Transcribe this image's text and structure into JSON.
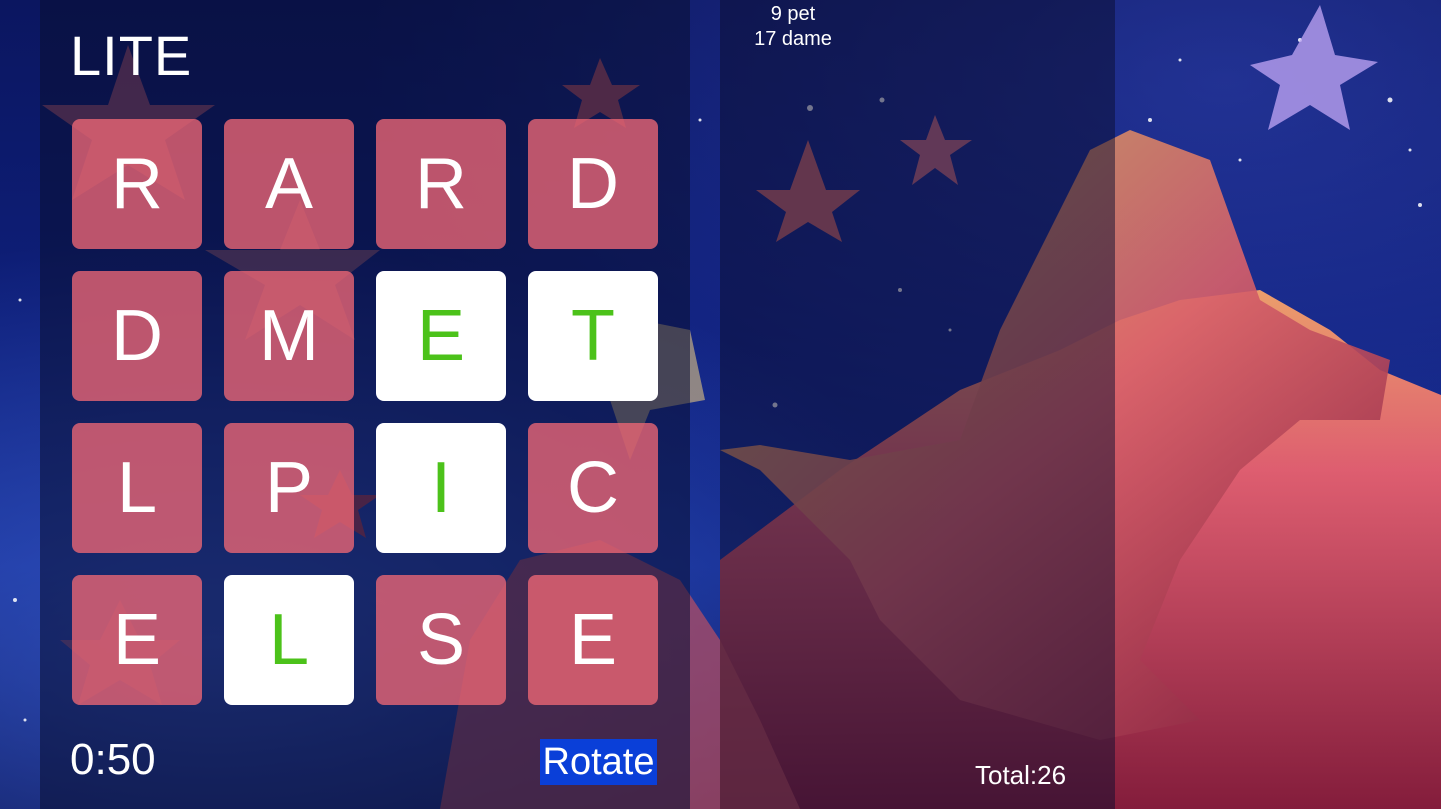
{
  "game": {
    "mode": "LITE",
    "timer": "0:50",
    "rotate_label": "Rotate",
    "total": "Total:26"
  },
  "board": {
    "rows": [
      [
        {
          "letter": "R",
          "selected": false
        },
        {
          "letter": "A",
          "selected": false
        },
        {
          "letter": "R",
          "selected": false
        },
        {
          "letter": "D",
          "selected": false
        }
      ],
      [
        {
          "letter": "D",
          "selected": false
        },
        {
          "letter": "M",
          "selected": false
        },
        {
          "letter": "E",
          "selected": true
        },
        {
          "letter": "T",
          "selected": true
        }
      ],
      [
        {
          "letter": "L",
          "selected": false
        },
        {
          "letter": "P",
          "selected": false
        },
        {
          "letter": "I",
          "selected": true
        },
        {
          "letter": "C",
          "selected": false
        }
      ],
      [
        {
          "letter": "E",
          "selected": false
        },
        {
          "letter": "L",
          "selected": true
        },
        {
          "letter": "S",
          "selected": false
        },
        {
          "letter": "E",
          "selected": false
        }
      ]
    ]
  },
  "found_words": [
    "9 pet",
    "17 dame"
  ],
  "colors": {
    "tile": "#ee6874",
    "tile_selected": "#ffffff",
    "selected_letter": "#4cc21a",
    "rotate_button": "#0a3fd8"
  }
}
